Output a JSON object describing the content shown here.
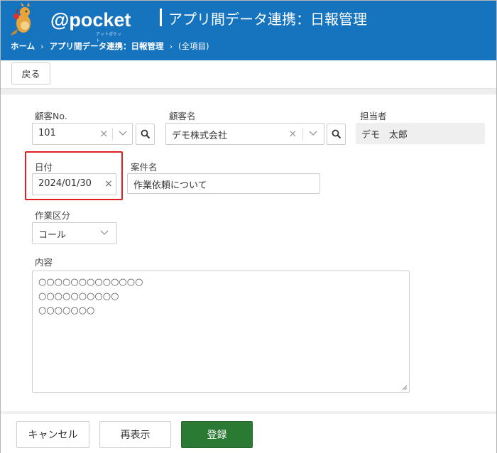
{
  "header": {
    "logo_text": "@pocket",
    "logo_sub": "アットポケット",
    "app_title": "アプリ間データ連携：日報管理",
    "brand_color": "#1674bf"
  },
  "breadcrumb": {
    "home": "ホーム",
    "app": "アプリ間データ連携：日報管理",
    "current": "(全項目)",
    "separator": "›"
  },
  "toolbar": {
    "back_label": "戻る"
  },
  "form": {
    "customer_no": {
      "label": "顧客No.",
      "value": "101"
    },
    "customer_name": {
      "label": "顧客名",
      "value": "デモ株式会社"
    },
    "person": {
      "label": "担当者",
      "value": "デモ　太郎"
    },
    "date": {
      "label": "日付",
      "value": "2024/01/30"
    },
    "subject": {
      "label": "案件名",
      "value": "作業依頼について"
    },
    "work_type": {
      "label": "作業区分",
      "value": "コール"
    },
    "content": {
      "label": "内容",
      "lines": [
        "○○○○○○○○○○○○○",
        "○○○○○○○○○○",
        "○○○○○○○"
      ]
    }
  },
  "footer": {
    "cancel_label": "キャンセル",
    "redisplay_label": "再表示",
    "register_label": "登録",
    "register_color": "#2b7a34"
  }
}
